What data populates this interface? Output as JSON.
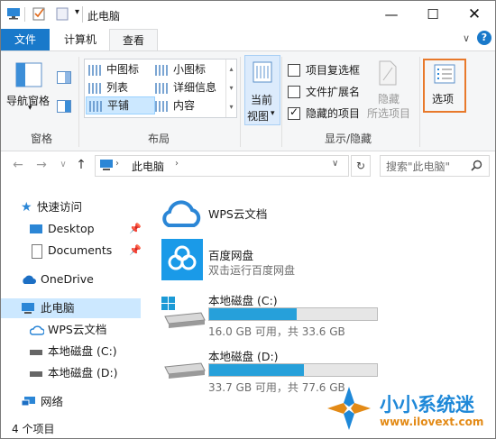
{
  "window": {
    "title": "此电脑"
  },
  "tabs": {
    "file": "文件",
    "computer": "计算机",
    "view": "查看"
  },
  "ribbon": {
    "pane": {
      "nav_pane": "导航窗格",
      "group": "窗格"
    },
    "layout": {
      "items": [
        "中图标",
        "小图标",
        "列表",
        "详细信息",
        "平铺",
        "内容"
      ],
      "group": "布局"
    },
    "current_view": {
      "line1": "当前",
      "line2": "视图"
    },
    "show_hide": {
      "item_checkboxes": "项目复选框",
      "file_extensions": "文件扩展名",
      "hidden_items": "隐藏的项目",
      "hide": "隐藏",
      "selected_items": "所选项目",
      "group": "显示/隐藏",
      "item_checkboxes_checked": false,
      "file_extensions_checked": false,
      "hidden_items_checked": true
    },
    "options": "选项"
  },
  "address": {
    "path": "此电脑",
    "search_placeholder": "搜索\"此电脑\""
  },
  "nav": {
    "quick_access": "快速访问",
    "desktop": "Desktop",
    "documents": "Documents",
    "onedrive": "OneDrive",
    "this_pc": "此电脑",
    "wps": "WPS云文档",
    "drive_c": "本地磁盘 (C:)",
    "drive_d": "本地磁盘 (D:)",
    "network": "网络"
  },
  "content": {
    "wps": {
      "name": "WPS云文档"
    },
    "baidu": {
      "name": "百度网盘",
      "sub": "双击运行百度网盘"
    },
    "drive_c": {
      "name": "本地磁盘 (C:)",
      "usage": "16.0 GB 可用，共 33.6 GB",
      "used_fraction": 0.524
    },
    "drive_d": {
      "name": "本地磁盘 (D:)",
      "usage": "33.7 GB 可用，共 77.6 GB",
      "used_fraction": 0.566
    }
  },
  "status": {
    "count": "4 个项目"
  },
  "watermark": {
    "brand": "小小系统迷",
    "url": "www.ilovext.com"
  },
  "colors": {
    "accent": "#1979ca",
    "selection": "#cce8ff",
    "bar": "#26a0da",
    "highlight": "#e8792b"
  }
}
